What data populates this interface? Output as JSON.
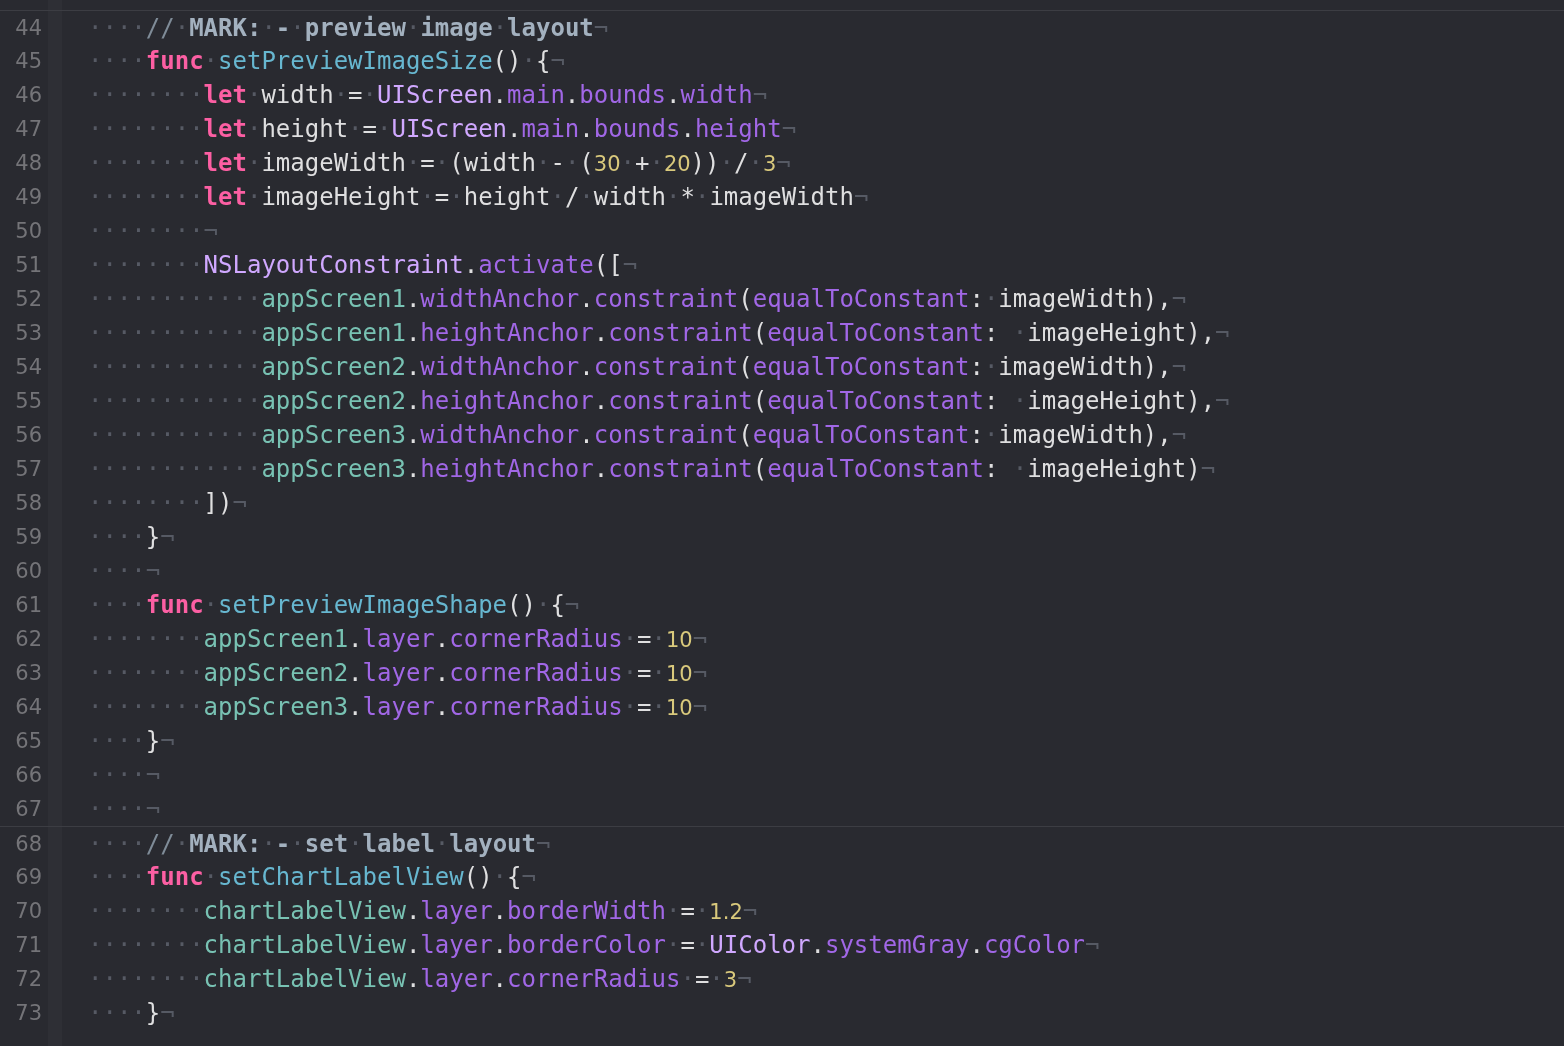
{
  "editor": {
    "lines": [
      {
        "number": "44",
        "separator": true,
        "tokens": [
          {
            "kind": "space",
            "text": "····"
          },
          {
            "kind": "comment",
            "text": "//"
          },
          {
            "kind": "space",
            "text": "·"
          },
          {
            "kind": "mark",
            "text": "MARK:"
          },
          {
            "kind": "space",
            "text": "·"
          },
          {
            "kind": "mark",
            "text": "-"
          },
          {
            "kind": "space",
            "text": "·"
          },
          {
            "kind": "mark",
            "text": "preview"
          },
          {
            "kind": "space",
            "text": "·"
          },
          {
            "kind": "mark",
            "text": "image"
          },
          {
            "kind": "space",
            "text": "·"
          },
          {
            "kind": "mark",
            "text": "layout"
          },
          {
            "kind": "space",
            "text": "¬"
          }
        ]
      },
      {
        "number": "45",
        "separator": false,
        "tokens": [
          {
            "kind": "space",
            "text": "····"
          },
          {
            "kind": "keyword",
            "text": "func"
          },
          {
            "kind": "space",
            "text": "·"
          },
          {
            "kind": "function",
            "text": "setPreviewImageSize"
          },
          {
            "kind": "plain",
            "text": "()"
          },
          {
            "kind": "space",
            "text": "·"
          },
          {
            "kind": "plain",
            "text": "{"
          },
          {
            "kind": "space",
            "text": "¬"
          }
        ]
      },
      {
        "number": "46",
        "separator": false,
        "tokens": [
          {
            "kind": "space",
            "text": "········"
          },
          {
            "kind": "keyword",
            "text": "let"
          },
          {
            "kind": "space",
            "text": "·"
          },
          {
            "kind": "plain",
            "text": "width"
          },
          {
            "kind": "space",
            "text": "·"
          },
          {
            "kind": "plain",
            "text": "="
          },
          {
            "kind": "space",
            "text": "·"
          },
          {
            "kind": "type",
            "text": "UIScreen"
          },
          {
            "kind": "plain",
            "text": "."
          },
          {
            "kind": "property",
            "text": "main"
          },
          {
            "kind": "plain",
            "text": "."
          },
          {
            "kind": "property",
            "text": "bounds"
          },
          {
            "kind": "plain",
            "text": "."
          },
          {
            "kind": "property",
            "text": "width"
          },
          {
            "kind": "space",
            "text": "¬"
          }
        ]
      },
      {
        "number": "47",
        "separator": false,
        "tokens": [
          {
            "kind": "space",
            "text": "········"
          },
          {
            "kind": "keyword",
            "text": "let"
          },
          {
            "kind": "space",
            "text": "·"
          },
          {
            "kind": "plain",
            "text": "height"
          },
          {
            "kind": "space",
            "text": "·"
          },
          {
            "kind": "plain",
            "text": "="
          },
          {
            "kind": "space",
            "text": "·"
          },
          {
            "kind": "type",
            "text": "UIScreen"
          },
          {
            "kind": "plain",
            "text": "."
          },
          {
            "kind": "property",
            "text": "main"
          },
          {
            "kind": "plain",
            "text": "."
          },
          {
            "kind": "property",
            "text": "bounds"
          },
          {
            "kind": "plain",
            "text": "."
          },
          {
            "kind": "property",
            "text": "height"
          },
          {
            "kind": "space",
            "text": "¬"
          }
        ]
      },
      {
        "number": "48",
        "separator": false,
        "tokens": [
          {
            "kind": "space",
            "text": "········"
          },
          {
            "kind": "keyword",
            "text": "let"
          },
          {
            "kind": "space",
            "text": "·"
          },
          {
            "kind": "plain",
            "text": "imageWidth"
          },
          {
            "kind": "space",
            "text": "·"
          },
          {
            "kind": "plain",
            "text": "="
          },
          {
            "kind": "space",
            "text": "·"
          },
          {
            "kind": "plain",
            "text": "(width"
          },
          {
            "kind": "space",
            "text": "·"
          },
          {
            "kind": "plain",
            "text": "-"
          },
          {
            "kind": "space",
            "text": "·"
          },
          {
            "kind": "plain",
            "text": "("
          },
          {
            "kind": "number",
            "text": "30"
          },
          {
            "kind": "space",
            "text": "·"
          },
          {
            "kind": "plain",
            "text": "+"
          },
          {
            "kind": "space",
            "text": "·"
          },
          {
            "kind": "number",
            "text": "20"
          },
          {
            "kind": "plain",
            "text": "))"
          },
          {
            "kind": "space",
            "text": "·"
          },
          {
            "kind": "plain",
            "text": "/"
          },
          {
            "kind": "space",
            "text": "·"
          },
          {
            "kind": "number",
            "text": "3"
          },
          {
            "kind": "space",
            "text": "¬"
          }
        ]
      },
      {
        "number": "49",
        "separator": false,
        "tokens": [
          {
            "kind": "space",
            "text": "········"
          },
          {
            "kind": "keyword",
            "text": "let"
          },
          {
            "kind": "space",
            "text": "·"
          },
          {
            "kind": "plain",
            "text": "imageHeight"
          },
          {
            "kind": "space",
            "text": "·"
          },
          {
            "kind": "plain",
            "text": "="
          },
          {
            "kind": "space",
            "text": "·"
          },
          {
            "kind": "plain",
            "text": "height"
          },
          {
            "kind": "space",
            "text": "·"
          },
          {
            "kind": "plain",
            "text": "/"
          },
          {
            "kind": "space",
            "text": "·"
          },
          {
            "kind": "plain",
            "text": "width"
          },
          {
            "kind": "space",
            "text": "·"
          },
          {
            "kind": "plain",
            "text": "*"
          },
          {
            "kind": "space",
            "text": "·"
          },
          {
            "kind": "plain",
            "text": "imageWidth"
          },
          {
            "kind": "space",
            "text": "¬"
          }
        ]
      },
      {
        "number": "50",
        "separator": false,
        "tokens": [
          {
            "kind": "space",
            "text": "········¬"
          }
        ]
      },
      {
        "number": "51",
        "separator": false,
        "tokens": [
          {
            "kind": "space",
            "text": "········"
          },
          {
            "kind": "type",
            "text": "NSLayoutConstraint"
          },
          {
            "kind": "plain",
            "text": "."
          },
          {
            "kind": "property",
            "text": "activate"
          },
          {
            "kind": "plain",
            "text": "(["
          },
          {
            "kind": "space",
            "text": "¬"
          }
        ]
      },
      {
        "number": "52",
        "separator": false,
        "tokens": [
          {
            "kind": "space",
            "text": "············"
          },
          {
            "kind": "identifier",
            "text": "appScreen1"
          },
          {
            "kind": "plain",
            "text": "."
          },
          {
            "kind": "property",
            "text": "widthAnchor"
          },
          {
            "kind": "plain",
            "text": "."
          },
          {
            "kind": "property",
            "text": "constraint"
          },
          {
            "kind": "plain",
            "text": "("
          },
          {
            "kind": "property",
            "text": "equalToConstant"
          },
          {
            "kind": "plain",
            "text": ":"
          },
          {
            "kind": "space",
            "text": "·"
          },
          {
            "kind": "plain",
            "text": "imageWidth),"
          },
          {
            "kind": "space",
            "text": "¬"
          }
        ]
      },
      {
        "number": "53",
        "separator": false,
        "tokens": [
          {
            "kind": "space",
            "text": "············"
          },
          {
            "kind": "identifier",
            "text": "appScreen1"
          },
          {
            "kind": "plain",
            "text": "."
          },
          {
            "kind": "property",
            "text": "heightAnchor"
          },
          {
            "kind": "plain",
            "text": "."
          },
          {
            "kind": "property",
            "text": "constraint"
          },
          {
            "kind": "plain",
            "text": "("
          },
          {
            "kind": "property",
            "text": "equalToConstant"
          },
          {
            "kind": "plain",
            "text": ": "
          },
          {
            "kind": "space",
            "text": "·"
          },
          {
            "kind": "plain",
            "text": "imageHeight),"
          },
          {
            "kind": "space",
            "text": "¬"
          }
        ]
      },
      {
        "number": "54",
        "separator": false,
        "tokens": [
          {
            "kind": "space",
            "text": "············"
          },
          {
            "kind": "identifier",
            "text": "appScreen2"
          },
          {
            "kind": "plain",
            "text": "."
          },
          {
            "kind": "property",
            "text": "widthAnchor"
          },
          {
            "kind": "plain",
            "text": "."
          },
          {
            "kind": "property",
            "text": "constraint"
          },
          {
            "kind": "plain",
            "text": "("
          },
          {
            "kind": "property",
            "text": "equalToConstant"
          },
          {
            "kind": "plain",
            "text": ":"
          },
          {
            "kind": "space",
            "text": "·"
          },
          {
            "kind": "plain",
            "text": "imageWidth),"
          },
          {
            "kind": "space",
            "text": "¬"
          }
        ]
      },
      {
        "number": "55",
        "separator": false,
        "tokens": [
          {
            "kind": "space",
            "text": "············"
          },
          {
            "kind": "identifier",
            "text": "appScreen2"
          },
          {
            "kind": "plain",
            "text": "."
          },
          {
            "kind": "property",
            "text": "heightAnchor"
          },
          {
            "kind": "plain",
            "text": "."
          },
          {
            "kind": "property",
            "text": "constraint"
          },
          {
            "kind": "plain",
            "text": "("
          },
          {
            "kind": "property",
            "text": "equalToConstant"
          },
          {
            "kind": "plain",
            "text": ": "
          },
          {
            "kind": "space",
            "text": "·"
          },
          {
            "kind": "plain",
            "text": "imageHeight),"
          },
          {
            "kind": "space",
            "text": "¬"
          }
        ]
      },
      {
        "number": "56",
        "separator": false,
        "tokens": [
          {
            "kind": "space",
            "text": "············"
          },
          {
            "kind": "identifier",
            "text": "appScreen3"
          },
          {
            "kind": "plain",
            "text": "."
          },
          {
            "kind": "property",
            "text": "widthAnchor"
          },
          {
            "kind": "plain",
            "text": "."
          },
          {
            "kind": "property",
            "text": "constraint"
          },
          {
            "kind": "plain",
            "text": "("
          },
          {
            "kind": "property",
            "text": "equalToConstant"
          },
          {
            "kind": "plain",
            "text": ":"
          },
          {
            "kind": "space",
            "text": "·"
          },
          {
            "kind": "plain",
            "text": "imageWidth),"
          },
          {
            "kind": "space",
            "text": "¬"
          }
        ]
      },
      {
        "number": "57",
        "separator": false,
        "tokens": [
          {
            "kind": "space",
            "text": "············"
          },
          {
            "kind": "identifier",
            "text": "appScreen3"
          },
          {
            "kind": "plain",
            "text": "."
          },
          {
            "kind": "property",
            "text": "heightAnchor"
          },
          {
            "kind": "plain",
            "text": "."
          },
          {
            "kind": "property",
            "text": "constraint"
          },
          {
            "kind": "plain",
            "text": "("
          },
          {
            "kind": "property",
            "text": "equalToConstant"
          },
          {
            "kind": "plain",
            "text": ": "
          },
          {
            "kind": "space",
            "text": "·"
          },
          {
            "kind": "plain",
            "text": "imageHeight)"
          },
          {
            "kind": "space",
            "text": "¬"
          }
        ]
      },
      {
        "number": "58",
        "separator": false,
        "tokens": [
          {
            "kind": "space",
            "text": "········"
          },
          {
            "kind": "plain",
            "text": "])"
          },
          {
            "kind": "space",
            "text": "¬"
          }
        ]
      },
      {
        "number": "59",
        "separator": false,
        "tokens": [
          {
            "kind": "space",
            "text": "····"
          },
          {
            "kind": "plain",
            "text": "}"
          },
          {
            "kind": "space",
            "text": "¬"
          }
        ]
      },
      {
        "number": "60",
        "separator": false,
        "tokens": [
          {
            "kind": "space",
            "text": "····¬"
          }
        ]
      },
      {
        "number": "61",
        "separator": false,
        "tokens": [
          {
            "kind": "space",
            "text": "····"
          },
          {
            "kind": "keyword",
            "text": "func"
          },
          {
            "kind": "space",
            "text": "·"
          },
          {
            "kind": "function",
            "text": "setPreviewImageShape"
          },
          {
            "kind": "plain",
            "text": "()"
          },
          {
            "kind": "space",
            "text": "·"
          },
          {
            "kind": "plain",
            "text": "{"
          },
          {
            "kind": "space",
            "text": "¬"
          }
        ]
      },
      {
        "number": "62",
        "separator": false,
        "tokens": [
          {
            "kind": "space",
            "text": "········"
          },
          {
            "kind": "identifier",
            "text": "appScreen1"
          },
          {
            "kind": "plain",
            "text": "."
          },
          {
            "kind": "property",
            "text": "layer"
          },
          {
            "kind": "plain",
            "text": "."
          },
          {
            "kind": "property",
            "text": "cornerRadius"
          },
          {
            "kind": "space",
            "text": "·"
          },
          {
            "kind": "plain",
            "text": "="
          },
          {
            "kind": "space",
            "text": "·"
          },
          {
            "kind": "number",
            "text": "10"
          },
          {
            "kind": "space",
            "text": "¬"
          }
        ]
      },
      {
        "number": "63",
        "separator": false,
        "tokens": [
          {
            "kind": "space",
            "text": "········"
          },
          {
            "kind": "identifier",
            "text": "appScreen2"
          },
          {
            "kind": "plain",
            "text": "."
          },
          {
            "kind": "property",
            "text": "layer"
          },
          {
            "kind": "plain",
            "text": "."
          },
          {
            "kind": "property",
            "text": "cornerRadius"
          },
          {
            "kind": "space",
            "text": "·"
          },
          {
            "kind": "plain",
            "text": "="
          },
          {
            "kind": "space",
            "text": "·"
          },
          {
            "kind": "number",
            "text": "10"
          },
          {
            "kind": "space",
            "text": "¬"
          }
        ]
      },
      {
        "number": "64",
        "separator": false,
        "tokens": [
          {
            "kind": "space",
            "text": "········"
          },
          {
            "kind": "identifier",
            "text": "appScreen3"
          },
          {
            "kind": "plain",
            "text": "."
          },
          {
            "kind": "property",
            "text": "layer"
          },
          {
            "kind": "plain",
            "text": "."
          },
          {
            "kind": "property",
            "text": "cornerRadius"
          },
          {
            "kind": "space",
            "text": "·"
          },
          {
            "kind": "plain",
            "text": "="
          },
          {
            "kind": "space",
            "text": "·"
          },
          {
            "kind": "number",
            "text": "10"
          },
          {
            "kind": "space",
            "text": "¬"
          }
        ]
      },
      {
        "number": "65",
        "separator": false,
        "tokens": [
          {
            "kind": "space",
            "text": "····"
          },
          {
            "kind": "plain",
            "text": "}"
          },
          {
            "kind": "space",
            "text": "¬"
          }
        ]
      },
      {
        "number": "66",
        "separator": false,
        "tokens": [
          {
            "kind": "space",
            "text": "····¬"
          }
        ]
      },
      {
        "number": "67",
        "separator": false,
        "tokens": [
          {
            "kind": "space",
            "text": "····¬"
          }
        ]
      },
      {
        "number": "68",
        "separator": true,
        "tokens": [
          {
            "kind": "space",
            "text": "····"
          },
          {
            "kind": "comment",
            "text": "//"
          },
          {
            "kind": "space",
            "text": "·"
          },
          {
            "kind": "mark",
            "text": "MARK:"
          },
          {
            "kind": "space",
            "text": "·"
          },
          {
            "kind": "mark",
            "text": "-"
          },
          {
            "kind": "space",
            "text": "·"
          },
          {
            "kind": "mark",
            "text": "set"
          },
          {
            "kind": "space",
            "text": "·"
          },
          {
            "kind": "mark",
            "text": "label"
          },
          {
            "kind": "space",
            "text": "·"
          },
          {
            "kind": "mark",
            "text": "layout"
          },
          {
            "kind": "space",
            "text": "¬"
          }
        ]
      },
      {
        "number": "69",
        "separator": false,
        "tokens": [
          {
            "kind": "space",
            "text": "····"
          },
          {
            "kind": "keyword",
            "text": "func"
          },
          {
            "kind": "space",
            "text": "·"
          },
          {
            "kind": "function",
            "text": "setChartLabelView"
          },
          {
            "kind": "plain",
            "text": "()"
          },
          {
            "kind": "space",
            "text": "·"
          },
          {
            "kind": "plain",
            "text": "{"
          },
          {
            "kind": "space",
            "text": "¬"
          }
        ]
      },
      {
        "number": "70",
        "separator": false,
        "tokens": [
          {
            "kind": "space",
            "text": "········"
          },
          {
            "kind": "identifier",
            "text": "chartLabelView"
          },
          {
            "kind": "plain",
            "text": "."
          },
          {
            "kind": "property",
            "text": "layer"
          },
          {
            "kind": "plain",
            "text": "."
          },
          {
            "kind": "property",
            "text": "borderWidth"
          },
          {
            "kind": "space",
            "text": "·"
          },
          {
            "kind": "plain",
            "text": "="
          },
          {
            "kind": "space",
            "text": "·"
          },
          {
            "kind": "number",
            "text": "1.2"
          },
          {
            "kind": "space",
            "text": "¬"
          }
        ]
      },
      {
        "number": "71",
        "separator": false,
        "tokens": [
          {
            "kind": "space",
            "text": "········"
          },
          {
            "kind": "identifier",
            "text": "chartLabelView"
          },
          {
            "kind": "plain",
            "text": "."
          },
          {
            "kind": "property",
            "text": "layer"
          },
          {
            "kind": "plain",
            "text": "."
          },
          {
            "kind": "property",
            "text": "borderColor"
          },
          {
            "kind": "space",
            "text": "·"
          },
          {
            "kind": "plain",
            "text": "="
          },
          {
            "kind": "space",
            "text": "·"
          },
          {
            "kind": "type",
            "text": "UIColor"
          },
          {
            "kind": "plain",
            "text": "."
          },
          {
            "kind": "property",
            "text": "systemGray"
          },
          {
            "kind": "plain",
            "text": "."
          },
          {
            "kind": "property",
            "text": "cgColor"
          },
          {
            "kind": "space",
            "text": "¬"
          }
        ]
      },
      {
        "number": "72",
        "separator": false,
        "tokens": [
          {
            "kind": "space",
            "text": "········"
          },
          {
            "kind": "identifier",
            "text": "chartLabelView"
          },
          {
            "kind": "plain",
            "text": "."
          },
          {
            "kind": "property",
            "text": "layer"
          },
          {
            "kind": "plain",
            "text": "."
          },
          {
            "kind": "property",
            "text": "cornerRadius"
          },
          {
            "kind": "space",
            "text": "·"
          },
          {
            "kind": "plain",
            "text": "="
          },
          {
            "kind": "space",
            "text": "·"
          },
          {
            "kind": "number",
            "text": "3"
          },
          {
            "kind": "space",
            "text": "¬"
          }
        ]
      },
      {
        "number": "73",
        "separator": false,
        "tokens": [
          {
            "kind": "space",
            "text": "····"
          },
          {
            "kind": "plain",
            "text": "}"
          },
          {
            "kind": "space",
            "text": "¬"
          }
        ]
      }
    ]
  }
}
